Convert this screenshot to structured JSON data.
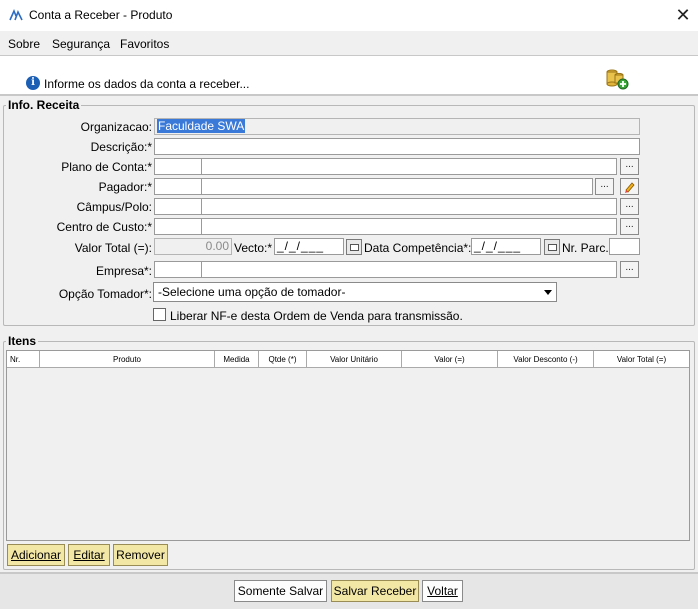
{
  "window": {
    "title": "Conta a Receber - Produto",
    "close": "✕"
  },
  "menu": {
    "items": [
      "Sobre",
      "Segurança",
      "Favoritos"
    ]
  },
  "info": {
    "icon_letter": "i",
    "message": "Informe os dados da conta a receber..."
  },
  "receita": {
    "legend": "Info. Receita",
    "organizacao": {
      "label": "Organizacao:",
      "value": "Faculdade SWA"
    },
    "descricao": {
      "label": "Descrição:*"
    },
    "plano": {
      "label": "Plano de Conta:*"
    },
    "pagador": {
      "label": "Pagador:*"
    },
    "campus": {
      "label": "Câmpus/Polo:"
    },
    "centro": {
      "label": "Centro de Custo:*"
    },
    "valor": {
      "label": "Valor Total (=):",
      "value": "0.00"
    },
    "vecto": {
      "label": "Vecto:*",
      "value": "_/_/___"
    },
    "competencia": {
      "label": "Data Competência*:",
      "value": "_/_/___"
    },
    "parc": {
      "label": "Nr. Parc.:"
    },
    "empresa": {
      "label": "Empresa*:"
    },
    "tomador": {
      "label": "Opção Tomador*:",
      "value": "-Selecione uma opção de tomador-"
    },
    "liberar": {
      "label": "Liberar NF-e desta Ordem de Venda para transmissão."
    },
    "dots": "..."
  },
  "itens": {
    "legend": "Itens",
    "columns": [
      "Nr.",
      "Produto",
      "Medida",
      "Qtde (*)",
      "Valor Unitário",
      "Valor (=)",
      "Valor Desconto (-)",
      "Valor Total (=)"
    ]
  },
  "item_buttons": {
    "adicionar": "Adicionar",
    "editar": "Editar",
    "remover": "Remover"
  },
  "footer": {
    "somente_salvar": "Somente Salvar",
    "salvar_receber": "Salvar Receber",
    "voltar": "Voltar"
  }
}
